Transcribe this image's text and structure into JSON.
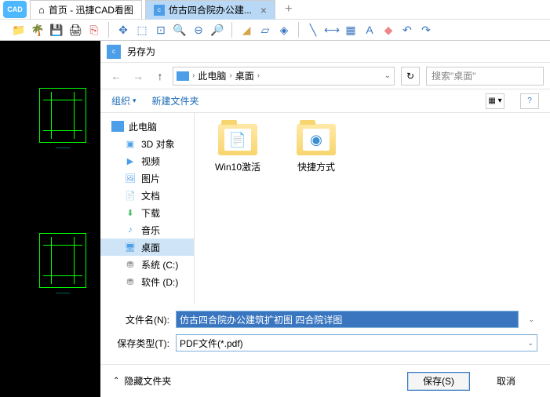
{
  "app": {
    "icon_text": "CAD"
  },
  "tabs": {
    "home": "首页 - 迅捷CAD看图",
    "active": "仿古四合院办公建...",
    "plus": "+"
  },
  "dialog": {
    "title": "另存为",
    "breadcrumb": {
      "pc": "此电脑",
      "desktop": "桌面"
    },
    "search_placeholder": "搜索\"桌面\"",
    "toolbar": {
      "organize": "组织",
      "new_folder": "新建文件夹"
    },
    "tree": {
      "this_pc": "此电脑",
      "objects3d": "3D 对象",
      "videos": "视频",
      "pictures": "图片",
      "documents": "文档",
      "downloads": "下载",
      "music": "音乐",
      "desktop": "桌面",
      "system_c": "系统 (C:)",
      "software_d": "软件 (D:)"
    },
    "files": {
      "item1": "Win10激活",
      "item2": "快捷方式"
    },
    "filename_label": "文件名(N):",
    "filename_value": "仿古四合院办公建筑扩初图 四合院详图",
    "filetype_label": "保存类型(T):",
    "filetype_value": "PDF文件(*.pdf)",
    "hide_folders": "隐藏文件夹",
    "save_btn": "保存(S)",
    "cancel_btn": "取消"
  }
}
